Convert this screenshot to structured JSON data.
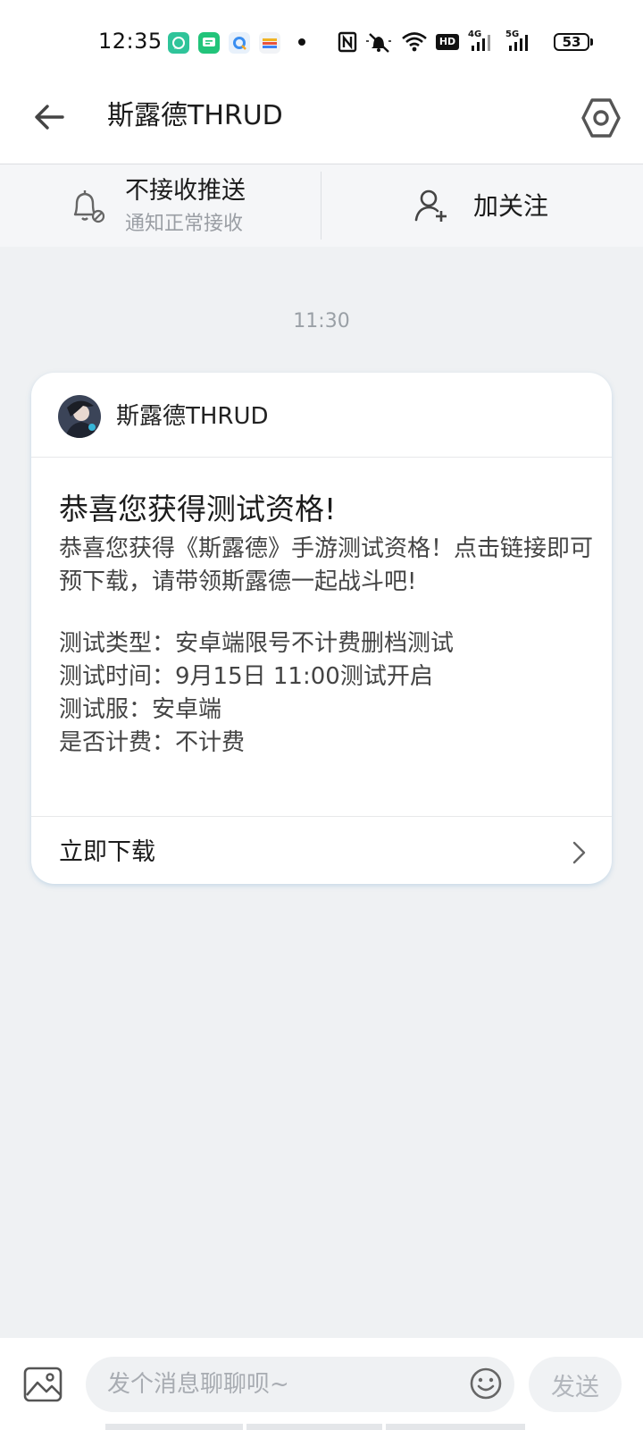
{
  "status_bar": {
    "time": "12:35",
    "icons": [
      "chat-app-icon",
      "message-app-icon",
      "qq-browser-icon",
      "wallet-icon",
      "nfc-icon",
      "mute-icon",
      "wifi-icon",
      "hd-icon",
      "4g-signal-icon",
      "5g-signal-icon"
    ],
    "hd_label": "HD",
    "net_4g": "4G",
    "net_5g": "5G",
    "battery": "53"
  },
  "header": {
    "title": "斯露德THRUD"
  },
  "subscription": {
    "push_label": "不接收推送",
    "push_hint": "通知正常接收",
    "follow_label": "加关注"
  },
  "chat": {
    "timestamp": "11:30",
    "card": {
      "sender": "斯露德THRUD",
      "title": "恭喜您获得测试资格!",
      "body": "恭喜您获得《斯露德》手游测试资格！点击链接即可预下载，请带领斯露德一起战斗吧!",
      "details": [
        "测试类型：安卓端限号不计费删档测试",
        "测试时间：9月15日 11:00测试开启",
        "测试服：安卓端",
        "是否计费：不计费"
      ],
      "action_label": "立即下载"
    }
  },
  "input_bar": {
    "placeholder": "发个消息聊聊呗~",
    "send_label": "发送"
  },
  "colors": {
    "background": "#eff1f3",
    "card": "#ffffff",
    "text_primary": "#1c1c1c",
    "text_secondary": "#9a9ea4"
  }
}
